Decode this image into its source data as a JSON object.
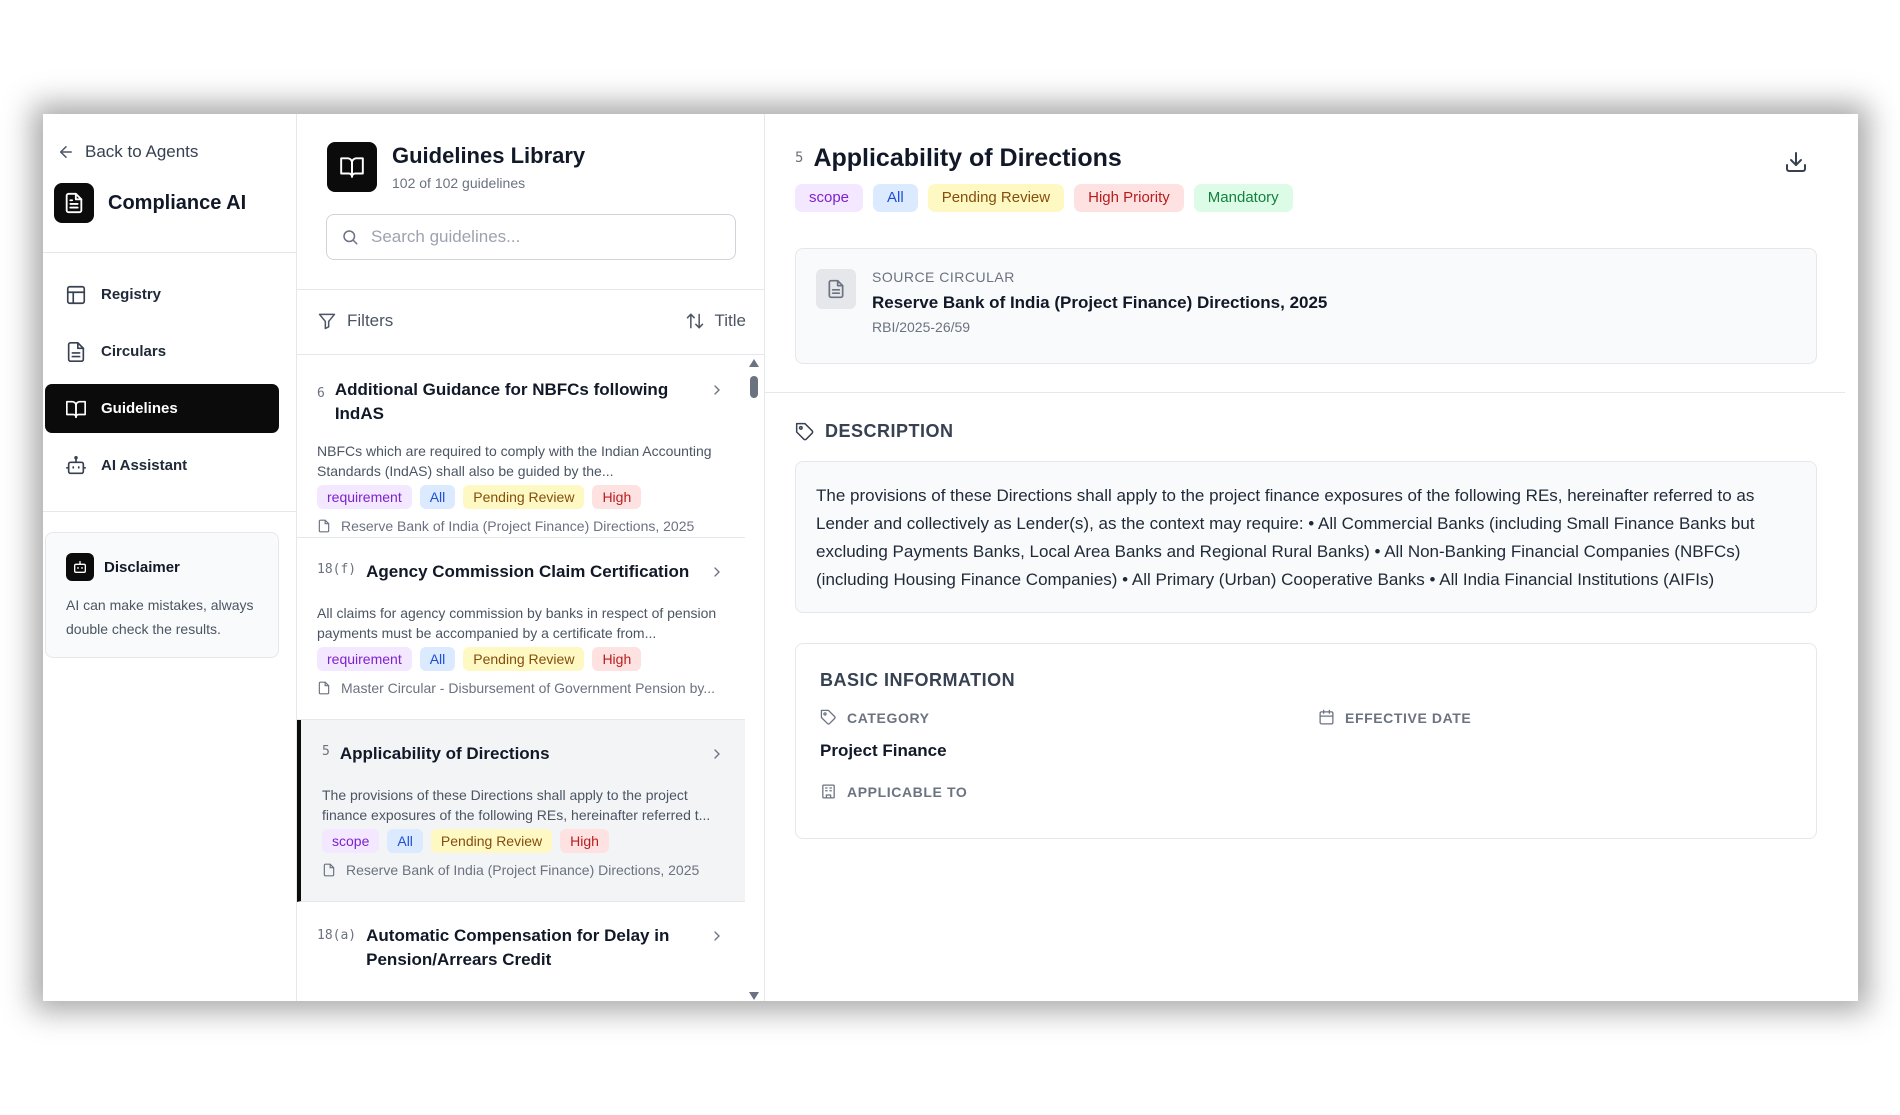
{
  "sidebar": {
    "back_label": "Back to Agents",
    "brand_title": "Compliance AI",
    "nav": [
      {
        "label": "Registry",
        "icon": "table-icon"
      },
      {
        "label": "Circulars",
        "icon": "document-icon"
      },
      {
        "label": "Guidelines",
        "icon": "book-icon",
        "active": true
      },
      {
        "label": "AI Assistant",
        "icon": "bot-icon"
      }
    ],
    "disclaimer": {
      "title": "Disclaimer",
      "text": "AI can make mistakes, always double check the results."
    }
  },
  "library": {
    "title": "Guidelines Library",
    "count": "102 of 102 guidelines",
    "search_placeholder": "Search guidelines...",
    "filters_label": "Filters",
    "sort_label": "Title",
    "cards": [
      {
        "num": "6",
        "title": "Additional Guidance for NBFCs following IndAS",
        "desc": "NBFCs which are required to comply with the Indian Accounting Standards (IndAS) shall also be guided by the...",
        "tags": [
          "requirement",
          "All",
          "Pending Review",
          "High"
        ],
        "source": "Reserve Bank of India (Project Finance) Directions, 2025"
      },
      {
        "num": "18(f)",
        "title": "Agency Commission Claim Certification",
        "desc": "All claims for agency commission by banks in respect of pension payments must be accompanied by a certificate from...",
        "tags": [
          "requirement",
          "All",
          "Pending Review",
          "High"
        ],
        "source": "Master Circular - Disbursement of Government Pension by..."
      },
      {
        "num": "5",
        "title": "Applicability of Directions",
        "desc": "The provisions of these Directions shall apply to the project finance exposures of the following REs, hereinafter referred t...",
        "tags": [
          "scope",
          "All",
          "Pending Review",
          "High"
        ],
        "source": "Reserve Bank of India (Project Finance) Directions, 2025"
      },
      {
        "num": "18(a)",
        "title": "Automatic Compensation for Delay in Pension/Arrears Credit"
      }
    ]
  },
  "detail": {
    "num": "5",
    "title": "Applicability of Directions",
    "tags": [
      "scope",
      "All",
      "Pending Review",
      "High Priority",
      "Mandatory"
    ],
    "source_label": "SOURCE CIRCULAR",
    "source_name": "Reserve Bank of India (Project Finance) Directions, 2025",
    "source_code": "RBI/2025-26/59",
    "description_label": "DESCRIPTION",
    "description": "The provisions of these Directions shall apply to the project finance exposures of the following REs, hereinafter referred to as Lender and collectively as Lender(s), as the context may require: • All Commercial Banks (including Small Finance Banks but excluding Payments Banks, Local Area Banks and Regional Rural Banks) • All Non-Banking Financial Companies (NBFCs) (including Housing Finance Companies) • All Primary (Urban) Cooperative Banks • All India Financial Institutions (AIFIs)",
    "basic_info_label": "BASIC INFORMATION",
    "category_label": "CATEGORY",
    "category_value": "Project Finance",
    "effective_date_label": "EFFECTIVE DATE",
    "applicable_to_label": "APPLICABLE TO"
  },
  "colors": {
    "accent": "#0b0b0b",
    "tag_purple": "#f3e8ff",
    "tag_blue": "#dbeafe",
    "tag_yellow": "#fef9c3",
    "tag_red": "#fee2e2",
    "tag_green": "#dcfce7"
  }
}
